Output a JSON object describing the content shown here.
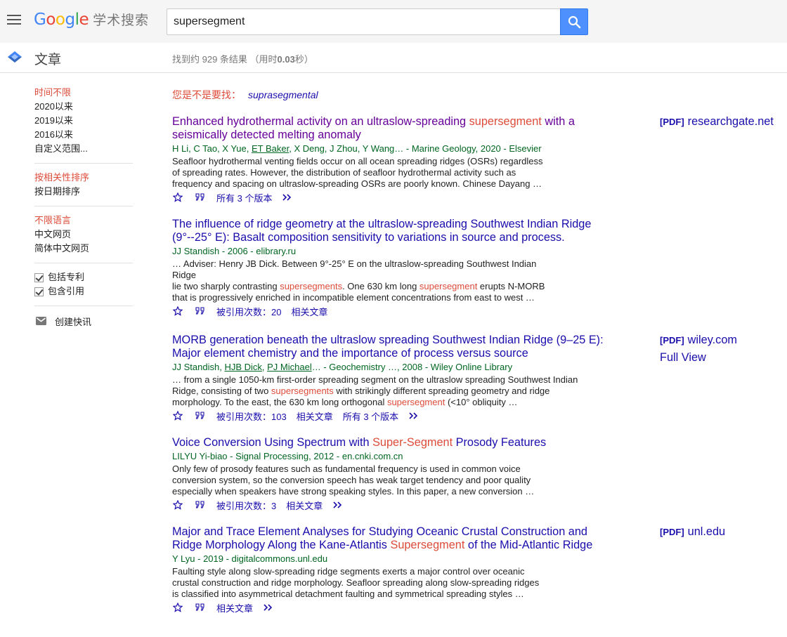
{
  "header": {
    "logo_text": "Google",
    "logo_zh": "学术搜索",
    "search_value": "supersegment"
  },
  "subheader": {
    "section_title": "文章",
    "stats_prefix": "找到约 929 条结果 （用时",
    "stats_time": "0.03",
    "stats_suffix": "秒）"
  },
  "sidebar": {
    "time_filters": [
      "时间不限",
      "2020以来",
      "2019以来",
      "2016以来",
      "自定义范围..."
    ],
    "sort_filters": [
      "按相关性排序",
      "按日期排序"
    ],
    "lang_filters": [
      "不限语言",
      "中文网页",
      "简体中文网页"
    ],
    "checks": [
      "包括专利",
      "包含引用"
    ],
    "alert": "创建快讯"
  },
  "did_you_mean": {
    "label": "您是不是要找：",
    "suggestion": "suprasegmental"
  },
  "results": [
    {
      "title_a": "Enhanced hydrothermal activity on an ultraslow-spreading ",
      "title_hl": "supersegment",
      "title_b": " with a seismically detected melting anomaly",
      "meta_a": "H Li, C Tao, X Yue, ",
      "meta_link": "ET Baker",
      "meta_b": ", X Deng, J Zhou, Y Wang… - Marine Geology, 2020 - Elsevier",
      "snippet_1": "Seafloor hydrothermal venting fields occur on all ocean spreading ridges (OSRs) regardless",
      "snippet_2": "of spreading rates. However, the distribution of seafloor hydrothermal activity such as",
      "snippet_3": "frequency and spacing on ultraslow-spreading OSRs are poorly known. Chinese Dayang …",
      "versions": "所有 3 个版本",
      "side_tag": "[PDF]",
      "side_domain": "researchgate.net"
    },
    {
      "title_a": "The influence of ridge geometry at the ultraslow-spreading Southwest Indian Ridge (9°--25° E): Basalt composition sensitivity to variations in source and process.",
      "meta": "JJ Standish - 2006 - elibrary.ru",
      "snippet_1": "… Adviser: Henry JB Dick. Between 9°-25° E on the ultraslow-spreading Southwest Indian Ridge",
      "snippet_2a": "lie two sharply contrasting ",
      "snippet_2hl1": "supersegments",
      "snippet_2b": ". One 630 km long ",
      "snippet_2hl2": "supersegment",
      "snippet_2c": " erupts N-MORB",
      "snippet_3": "that is progressively enriched in incompatible element concentrations from east to west …",
      "cited": "被引用次数：20",
      "related": "相关文章"
    },
    {
      "title_a": "MORB generation beneath the ultraslow spreading Southwest Indian Ridge (9–25 E): Major element chemistry and the importance of process versus source",
      "meta_a": "JJ Standish, ",
      "meta_link1": "HJB Dick",
      "meta_sep": ", ",
      "meta_link2": "PJ Michael",
      "meta_b": "… - Geochemistry …, 2008 - Wiley Online Library",
      "snippet_1": "… from a single 1050-km first-order spreading segment on the ultraslow spreading Southwest Indian",
      "snippet_2a": "Ridge, consisting of two ",
      "snippet_2hl": "supersegments",
      "snippet_2b": " with strikingly different spreading geometry and ridge",
      "snippet_3a": "morphology. To the east, the 630 km long orthogonal ",
      "snippet_3hl": "supersegment",
      "snippet_3b": " (<10° obliquity …",
      "cited": "被引用次数：103",
      "related": "相关文章",
      "versions": "所有 3 个版本",
      "side_tag": "[PDF]",
      "side_domain": "wiley.com",
      "side_extra": "Full View"
    },
    {
      "title_a": "Voice Conversion Using Spectrum with ",
      "title_hl": "Super-Segment",
      "title_b": " Prosody Features",
      "meta": "LILYU Yi-biao - Signal Processing, 2012 - en.cnki.com.cn",
      "snippet_1": "Only few of prosody features such as fundamental frequency is used in common voice",
      "snippet_2": "conversion system, so the conversion speech has weak target tendency and poor quality",
      "snippet_3": "especially when speakers have strong speaking styles. In this paper, a new conversion …",
      "cited": "被引用次数：3",
      "related": "相关文章"
    },
    {
      "title_a": "Major and Trace Element Analyses for Studying Oceanic Crustal Construction and Ridge Morphology Along the Kane-Atlantis ",
      "title_hl": "Supersegment",
      "title_b": " of the Mid-Atlantic Ridge",
      "meta": "Y Lyu - 2019 - digitalcommons.unl.edu",
      "snippet_1": "Faulting style along slow-spreading ridge segments exerts a major control over oceanic",
      "snippet_2": "crustal construction and ridge morphology. Seafloor spreading along slow-spreading ridges",
      "snippet_3": "is classified into asymmetrical detachment faulting and symmetrical spreading styles …",
      "related": "相关文章",
      "side_tag": "[PDF]",
      "side_domain": "unl.edu"
    }
  ]
}
